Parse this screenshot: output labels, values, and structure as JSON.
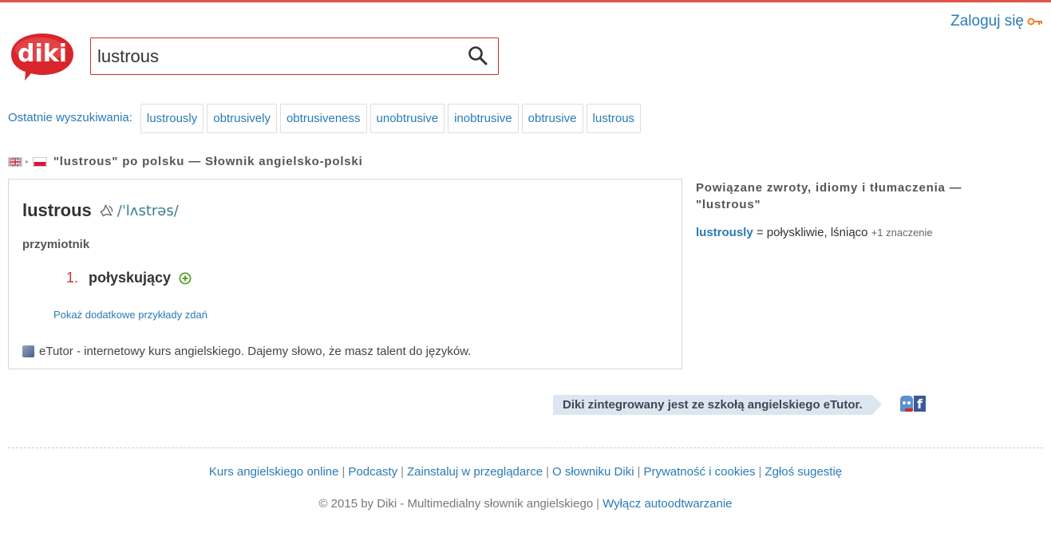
{
  "header": {
    "login_label": "Zaloguj się",
    "search_value": "lustrous",
    "colors": {
      "accent": "#e2554a",
      "link": "#2a7bb5"
    }
  },
  "recent": {
    "label": "Ostatnie wyszukiwania:",
    "items": [
      "lustrously",
      "obtrusively",
      "obtrusiveness",
      "unobtrusive",
      "inobtrusive",
      "obtrusive",
      "lustrous"
    ]
  },
  "heading": "\"lustrous\" po polsku — Słownik angielsko-polski",
  "entry": {
    "headword": "lustrous",
    "phonetic": "/ˈlʌstrəs/",
    "part_of_speech": "przymiotnik",
    "meanings": [
      {
        "number": "1.",
        "text": "połyskujący"
      }
    ],
    "more_examples": "Pokaż dodatkowe przykłady zdań",
    "etutor_text": "eTutor - internetowy kurs angielskiego. Dajemy słowo, że masz talent do języków."
  },
  "related": {
    "title": "Powiązane zwroty, idiomy i tłumaczenia — \"lustrous\"",
    "word": "lustrously",
    "equals": "=",
    "translation": "połyskliwie, lśniąco",
    "extra": "+1 znaczenie"
  },
  "promo": "Diki zintegrowany jest ze szkołą angielskiego eTutor.",
  "footer": {
    "links": [
      "Kurs angielskiego online",
      "Podcasty",
      "Zainstaluj w przeglądarce",
      "O słowniku Diki",
      "Prywatność i cookies",
      "Zgłoś sugestię"
    ],
    "copyright": "© 2015 by Diki - Multimedialny słownik angielskiego",
    "autoplay_link": "Wyłącz autoodtwarzanie"
  }
}
